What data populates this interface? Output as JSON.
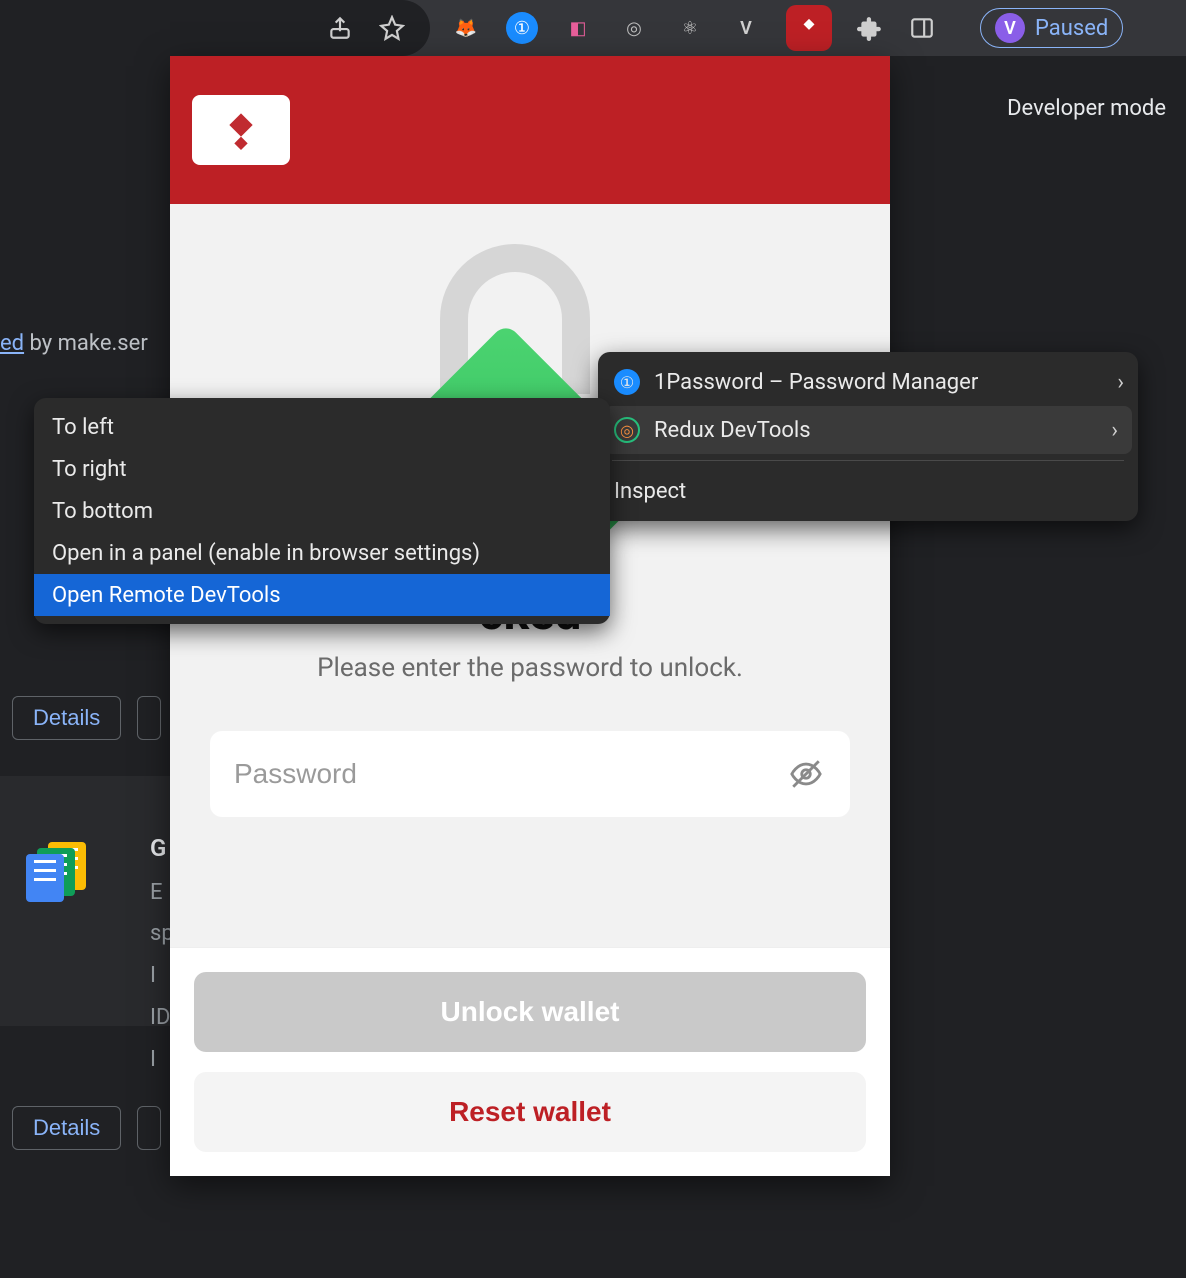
{
  "toolbar": {
    "share_icon": "share-icon",
    "star_icon": "star-icon",
    "extensions": [
      {
        "name": "metamask-icon",
        "color": "#e2761b",
        "glyph": "🦊"
      },
      {
        "name": "onepassword-icon",
        "color": "#1a8cff",
        "glyph": "①"
      },
      {
        "name": "color-tool-icon",
        "color": "#e85f9b",
        "glyph": "◧"
      },
      {
        "name": "redux-devtools-icon",
        "color": "#6b6b6b",
        "glyph": "◎"
      },
      {
        "name": "react-devtools-icon",
        "color": "#cfcfcf",
        "glyph": "⚛"
      },
      {
        "name": "letter-v-icon",
        "color": "#cfcfcf",
        "glyph": "V"
      }
    ],
    "active_ext_glyph": "◆",
    "puzzle_icon": "puzzle-icon",
    "panel_icon": "panel-icon",
    "profile_letter": "V",
    "paused_label": "Paused"
  },
  "background": {
    "developer_mode": "Developer mode",
    "link_text": "ed",
    "by_text": " by make.ser",
    "details_label": "Details",
    "card_title_prefix": "G",
    "card_lines": [
      "E",
      "sp",
      "I",
      "ID",
      "I"
    ]
  },
  "popup": {
    "title_suffix": "cked",
    "subtitle": "Please enter the password to unlock.",
    "password_placeholder": "Password",
    "unlock_label": "Unlock wallet",
    "reset_label": "Reset wallet"
  },
  "ctx_menu_primary": {
    "items": [
      {
        "label": "1Password – Password Manager",
        "icon": "onepassword-icon",
        "icon_bg": "#1a8cff",
        "has_sub": true,
        "hover": false
      },
      {
        "label": "Redux DevTools",
        "icon": "redux-devtools-icon",
        "icon_bg": "#27c07d",
        "has_sub": true,
        "hover": true
      }
    ],
    "inspect_label": "Inspect"
  },
  "ctx_menu_sub": {
    "items": [
      {
        "label": "To left",
        "selected": false
      },
      {
        "label": "To right",
        "selected": false
      },
      {
        "label": "To bottom",
        "selected": false
      },
      {
        "label": "Open in a panel (enable in browser settings)",
        "selected": false
      },
      {
        "label": "Open Remote DevTools",
        "selected": true
      }
    ]
  }
}
